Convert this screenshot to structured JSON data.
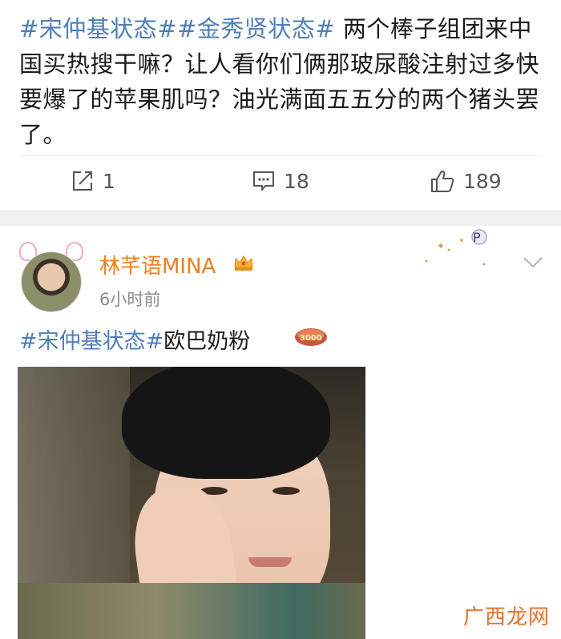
{
  "post1": {
    "tag1": "#宋仲基状态#",
    "tag2": "#金秀贤状态#",
    "body": " 两个棒子组团来中国买热搜干嘛？让人看你们俩那玻尿酸注射过多快要爆了的苹果肌吗？油光满面五五分的两个猪头罢了。",
    "actions": {
      "share_count": "1",
      "comment_count": "18",
      "like_count": "189"
    }
  },
  "post2": {
    "username": "林芊语MINA",
    "timestamp": "6小时前",
    "tag": "#宋仲基状态#",
    "body": "欧巴奶粉",
    "sticker_text": "3000"
  },
  "watermark": "广西龙网",
  "colors": {
    "hashtag": "#4f7db8",
    "username": "#f07f1a",
    "watermark": "#e3702e"
  },
  "icons": [
    "share-icon",
    "comment-icon",
    "like-icon",
    "vip-crown-icon",
    "chevron-down-icon"
  ]
}
